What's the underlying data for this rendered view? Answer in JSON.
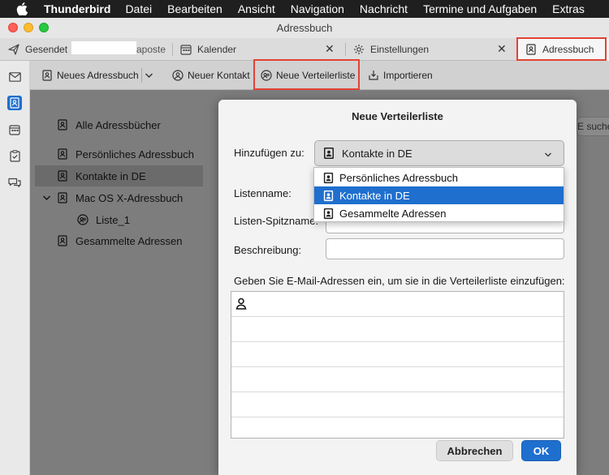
{
  "menubar": {
    "app": "Thunderbird",
    "items": [
      "Datei",
      "Bearbeiten",
      "Ansicht",
      "Navigation",
      "Nachricht",
      "Termine und Aufgaben",
      "Extras"
    ]
  },
  "window": {
    "title": "Adressbuch"
  },
  "tabs": [
    {
      "label": "Gesendet",
      "suffix": "aposte",
      "icon": "send-icon"
    },
    {
      "label": "Kalender",
      "icon": "calendar-icon"
    },
    {
      "label": "Einstellungen",
      "icon": "gear-icon"
    },
    {
      "label": "Adressbuch",
      "icon": "address-book-icon",
      "active": true
    }
  ],
  "toolbar": {
    "new_address_book": "Neues Adressbuch",
    "new_contact": "Neuer Kontakt",
    "new_list": "Neue Verteilerliste",
    "import": "Importieren"
  },
  "sidebar": {
    "all": "Alle Adressbücher",
    "items": [
      {
        "label": "Persönliches Adressbuch"
      },
      {
        "label": "Kontakte in DE",
        "selected": true
      },
      {
        "label": "Mac OS X-Adressbuch",
        "expanded": true
      },
      {
        "label": "Liste_1",
        "child": true
      },
      {
        "label": "Gesammelte Adressen"
      }
    ]
  },
  "search": {
    "placeholder_peek": "E suche"
  },
  "dialog": {
    "title": "Neue Verteilerliste",
    "add_to_label": "Hinzufügen zu:",
    "add_to_value": "Kontakte in DE",
    "options": [
      "Persönliches Adressbuch",
      "Kontakte in DE",
      "Gesammelte Adressen"
    ],
    "selected_option": "Kontakte in DE",
    "list_name_label": "Listenname:",
    "nickname_label": "Listen-Spitzname:",
    "description_label": "Beschreibung:",
    "emails_label": "Geben Sie E-Mail-Adressen ein, um sie in die Verteilerliste einzufügen:",
    "cancel": "Abbrechen",
    "ok": "OK"
  },
  "colors": {
    "accent": "#1f6fce",
    "highlight_box": "#e34234"
  }
}
